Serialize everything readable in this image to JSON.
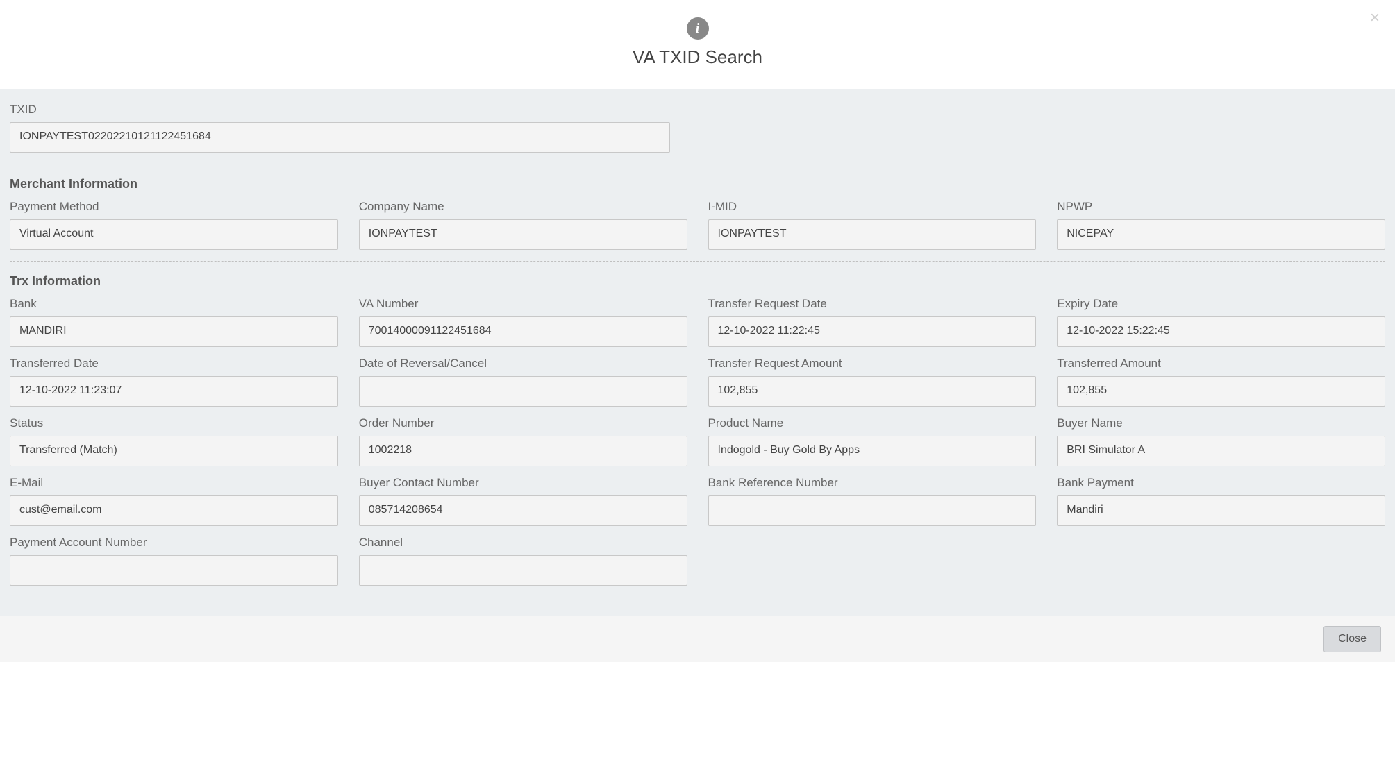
{
  "header": {
    "title": "VA TXID Search",
    "close_x": "×"
  },
  "txid": {
    "label": "TXID",
    "value": "IONPAYTEST02202210121122451684"
  },
  "sections": {
    "merchant": {
      "title": "Merchant Information",
      "payment_method": {
        "label": "Payment Method",
        "value": "Virtual Account"
      },
      "company_name": {
        "label": "Company Name",
        "value": "IONPAYTEST"
      },
      "imid": {
        "label": "I-MID",
        "value": "IONPAYTEST"
      },
      "npwp": {
        "label": "NPWP",
        "value": "NICEPAY"
      }
    },
    "trx": {
      "title": "Trx Information",
      "bank": {
        "label": "Bank",
        "value": "MANDIRI"
      },
      "va_number": {
        "label": "VA Number",
        "value": "70014000091122451684"
      },
      "transfer_request_date": {
        "label": "Transfer Request Date",
        "value": "12-10-2022 11:22:45"
      },
      "expiry_date": {
        "label": "Expiry Date",
        "value": "12-10-2022 15:22:45"
      },
      "transferred_date": {
        "label": "Transferred Date",
        "value": "12-10-2022 11:23:07"
      },
      "date_reversal": {
        "label": "Date of Reversal/Cancel",
        "value": ""
      },
      "transfer_request_amount": {
        "label": "Transfer Request Amount",
        "value": "102,855"
      },
      "transferred_amount": {
        "label": "Transferred Amount",
        "value": "102,855"
      },
      "status": {
        "label": "Status",
        "value": "Transferred (Match)"
      },
      "order_number": {
        "label": "Order Number",
        "value": "1002218"
      },
      "product_name": {
        "label": "Product Name",
        "value": "Indogold - Buy Gold By Apps"
      },
      "buyer_name": {
        "label": "Buyer Name",
        "value": "BRI Simulator A"
      },
      "email": {
        "label": "E-Mail",
        "value": "cust@email.com"
      },
      "buyer_contact": {
        "label": "Buyer Contact Number",
        "value": "085714208654"
      },
      "bank_reference": {
        "label": "Bank Reference Number",
        "value": ""
      },
      "bank_payment": {
        "label": "Bank Payment",
        "value": "Mandiri"
      },
      "payment_account": {
        "label": "Payment Account Number",
        "value": ""
      },
      "channel": {
        "label": "Channel",
        "value": ""
      }
    }
  },
  "footer": {
    "close_label": "Close"
  }
}
